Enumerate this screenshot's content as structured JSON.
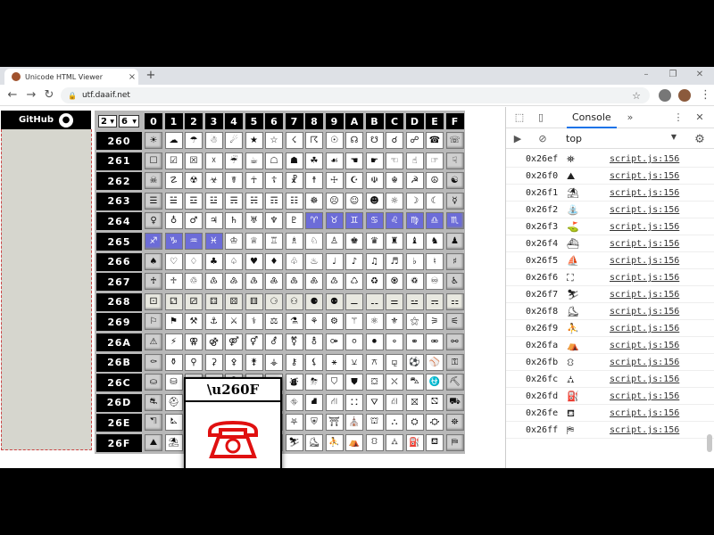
{
  "browser": {
    "tab_title": "Unicode HTML Viewer",
    "tab_close": "×",
    "new_tab": "+",
    "url": "utf.daaif.net",
    "win_min": "–",
    "win_max": "❐",
    "win_close": "✕"
  },
  "sidebar": {
    "github_label": "GitHub"
  },
  "grid": {
    "selector_1": "2",
    "selector_2": "6",
    "col_headers": [
      "0",
      "1",
      "2",
      "3",
      "4",
      "5",
      "6",
      "7",
      "8",
      "9",
      "A",
      "B",
      "C",
      "D",
      "E",
      "F"
    ],
    "row_headers": [
      "260",
      "261",
      "262",
      "263",
      "264",
      "265",
      "266",
      "267",
      "268",
      "269",
      "26A",
      "26B",
      "26C",
      "26D",
      "26E",
      "26F"
    ],
    "rows": [
      [
        "☀",
        "☁",
        "☂",
        "☃",
        "☄",
        "★",
        "☆",
        "☇",
        "☈",
        "☉",
        "☊",
        "☋",
        "☌",
        "☍",
        "☎",
        "☏"
      ],
      [
        "☐",
        "☑",
        "☒",
        "☓",
        "☔",
        "☕",
        "☖",
        "☗",
        "☘",
        "☙",
        "☚",
        "☛",
        "☜",
        "☝",
        "☞",
        "☟"
      ],
      [
        "☠",
        "☡",
        "☢",
        "☣",
        "☤",
        "☥",
        "☦",
        "☧",
        "☨",
        "☩",
        "☪",
        "☫",
        "☬",
        "☭",
        "☮",
        "☯"
      ],
      [
        "☰",
        "☱",
        "☲",
        "☳",
        "☴",
        "☵",
        "☶",
        "☷",
        "☸",
        "☹",
        "☺",
        "☻",
        "☼",
        "☽",
        "☾",
        "☿"
      ],
      [
        "♀",
        "♁",
        "♂",
        "♃",
        "♄",
        "♅",
        "♆",
        "♇",
        "♈",
        "♉",
        "♊",
        "♋",
        "♌",
        "♍",
        "♎",
        "♏"
      ],
      [
        "♐",
        "♑",
        "♒",
        "♓",
        "♔",
        "♕",
        "♖",
        "♗",
        "♘",
        "♙",
        "♚",
        "♛",
        "♜",
        "♝",
        "♞",
        "♟"
      ],
      [
        "♠",
        "♡",
        "♢",
        "♣",
        "♤",
        "♥",
        "♦",
        "♧",
        "♨",
        "♩",
        "♪",
        "♫",
        "♬",
        "♭",
        "♮",
        "♯"
      ],
      [
        "♰",
        "♱",
        "♲",
        "♳",
        "♴",
        "♵",
        "♶",
        "♷",
        "♸",
        "♹",
        "♺",
        "♻",
        "♼",
        "♽",
        "♾",
        "♿"
      ],
      [
        "⚀",
        "⚁",
        "⚂",
        "⚃",
        "⚄",
        "⚅",
        "⚆",
        "⚇",
        "⚈",
        "⚉",
        "⚊",
        "⚋",
        "⚌",
        "⚍",
        "⚎",
        "⚏"
      ],
      [
        "⚐",
        "⚑",
        "⚒",
        "⚓",
        "⚔",
        "⚕",
        "⚖",
        "⚗",
        "⚘",
        "⚙",
        "⚚",
        "⚛",
        "⚜",
        "⚝",
        "⚞",
        "⚟"
      ],
      [
        "⚠",
        "⚡",
        "⚢",
        "⚣",
        "⚤",
        "⚥",
        "⚦",
        "⚧",
        "⚨",
        "⚩",
        "⚪",
        "⚫",
        "⚬",
        "⚭",
        "⚮",
        "⚯"
      ],
      [
        "⚰",
        "⚱",
        "⚲",
        "⚳",
        "⚴",
        "⚵",
        "⚶",
        "⚷",
        "⚸",
        "⚹",
        "⚺",
        "⚻",
        "⚼",
        "⚽",
        "⚾",
        "⚿"
      ],
      [
        "⛀",
        "⛁",
        "⛂",
        "⛃",
        "⛄",
        "⛅",
        "⛆",
        "⛇",
        "⛈",
        "⛉",
        "⛊",
        "⛋",
        "⛌",
        "⛍",
        "⛎",
        "⛏"
      ],
      [
        "⛐",
        "⛑",
        "⛒",
        "⛓",
        "⛔",
        "⛕",
        "⛖",
        "⛗",
        "⛘",
        "⛙",
        "⛚",
        "⛛",
        "⛜",
        "⛝",
        "⛞",
        "⛟"
      ],
      [
        "⛠",
        "⛡",
        "⛢",
        "⛣",
        "⛤",
        "⛥",
        "⛦",
        "⛧",
        "⛨",
        "⛩",
        "⛪",
        "⛫",
        "⛬",
        "⛭",
        "⛮",
        "⛯"
      ],
      [
        "⛰",
        "⛱",
        "⛲",
        "⛳",
        "⛴",
        "⛵",
        "⛶",
        "⛷",
        "⛸",
        "⛹",
        "⛺",
        "⛻",
        "⛼",
        "⛽",
        "⛾",
        "⛿"
      ]
    ]
  },
  "popup": {
    "code": "\\u260F",
    "glyph_color": "#e01010"
  },
  "devtools": {
    "console_tab": "Console",
    "more_tabs": "»",
    "context": "top",
    "logs": [
      {
        "code": "0x26ef",
        "glyph": "⛯",
        "src": "script.js:156"
      },
      {
        "code": "0x26f0",
        "glyph": "⛰",
        "src": "script.js:156"
      },
      {
        "code": "0x26f1",
        "glyph": "⛱",
        "src": "script.js:156"
      },
      {
        "code": "0x26f2",
        "glyph": "⛲",
        "src": "script.js:156"
      },
      {
        "code": "0x26f3",
        "glyph": "⛳",
        "src": "script.js:156"
      },
      {
        "code": "0x26f4",
        "glyph": "⛴",
        "src": "script.js:156"
      },
      {
        "code": "0x26f5",
        "glyph": "⛵",
        "src": "script.js:156"
      },
      {
        "code": "0x26f6",
        "glyph": "⛶",
        "src": "script.js:156"
      },
      {
        "code": "0x26f7",
        "glyph": "⛷",
        "src": "script.js:156"
      },
      {
        "code": "0x26f8",
        "glyph": "⛸",
        "src": "script.js:156"
      },
      {
        "code": "0x26f9",
        "glyph": "⛹",
        "src": "script.js:156"
      },
      {
        "code": "0x26fa",
        "glyph": "⛺",
        "src": "script.js:156"
      },
      {
        "code": "0x26fb",
        "glyph": "⛻",
        "src": "script.js:156"
      },
      {
        "code": "0x26fc",
        "glyph": "⛼",
        "src": "script.js:156"
      },
      {
        "code": "0x26fd",
        "glyph": "⛽",
        "src": "script.js:156"
      },
      {
        "code": "0x26fe",
        "glyph": "⛾",
        "src": "script.js:156"
      },
      {
        "code": "0x26ff",
        "glyph": "⛿",
        "src": "script.js:156"
      }
    ],
    "prompt": "›"
  }
}
